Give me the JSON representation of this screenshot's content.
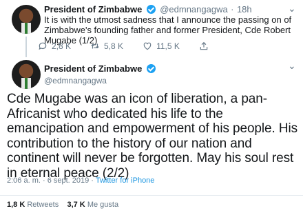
{
  "tweet1": {
    "name": "President of Zimbabwe",
    "handle": "@edmnangagwa",
    "separator": "·",
    "time": "18h",
    "text": "It is with the utmost sadness that I announce the passing on of Zimbabwe's founding father and former President, Cde Robert Mugabe (1/2)",
    "replies": "2,8 K",
    "retweets": "5,8 K",
    "likes": "11,5 K"
  },
  "tweet2": {
    "name": "President of Zimbabwe",
    "handle": "@edmnangagwa",
    "text": "Cde Mugabe was an icon of liberation, a pan-Africanist who dedicated his life to the emancipation and empowerment of his people. His contribution to the history of our nation and continent will never be forgotten. May his soul rest in eternal peace (2/2)",
    "timestamp": "2:06 a. m. · 6 sept. 2019 · ",
    "source": "Twitter for iPhone",
    "retweet_count": "1,8 K",
    "retweet_label": "Retweets",
    "like_count": "3,7 K",
    "like_label": "Me gusta"
  },
  "icons": [
    "reply-icon",
    "retweet-icon",
    "like-icon",
    "share-icon",
    "chevron-down-icon",
    "verified-icon"
  ],
  "colors": {
    "accent": "#1da1f2",
    "muted": "#657786",
    "text": "#14171a"
  }
}
